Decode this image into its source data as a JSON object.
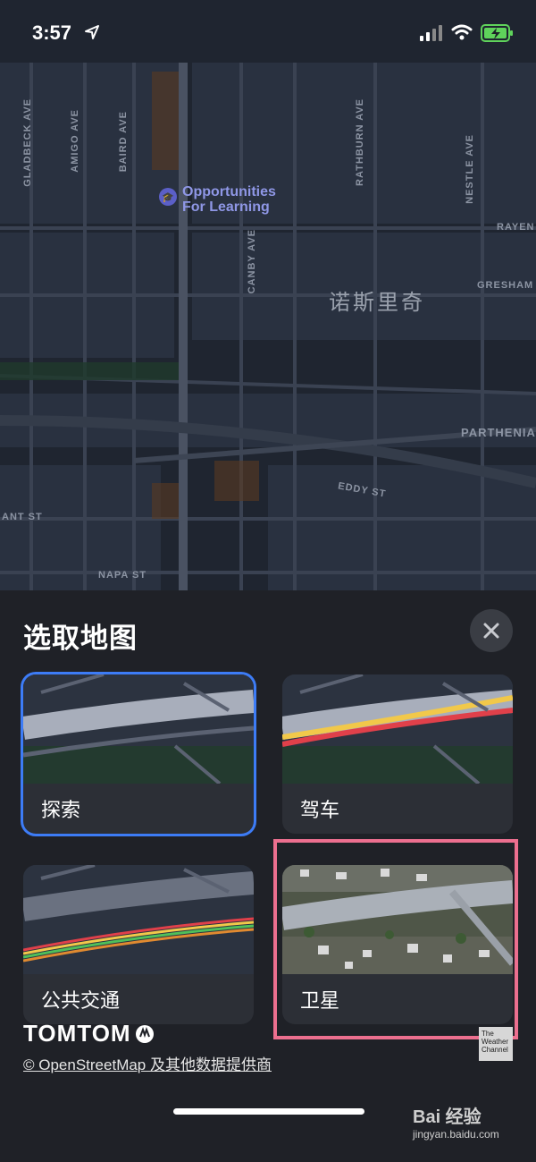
{
  "status_bar": {
    "time": "3:57"
  },
  "map": {
    "city_label": "诺斯里奇",
    "poi": {
      "line1": "Opportunities",
      "line2": "For Learning",
      "icon": "graduation-cap-icon"
    },
    "streets": {
      "gladbeck": "GLADBECK AVE",
      "amigo": "AMIGO AVE",
      "baird": "BAIRD AVE",
      "rathburn": "RATHBURN AVE",
      "nestle": "NESTLE AVE",
      "canby": "CANBY AVE",
      "rayen": "RAYEN",
      "gresham": "GRESHAM",
      "parthenia": "PARTHENIA",
      "eddy": "EDDY ST",
      "ant": "ANT ST",
      "napa": "NAPA ST"
    }
  },
  "sheet": {
    "title": "选取地图",
    "cards": [
      {
        "label": "探索"
      },
      {
        "label": "驾车"
      },
      {
        "label": "公共交通"
      },
      {
        "label": "卫星"
      }
    ],
    "brand": "TOMTOM",
    "attribution": "© OpenStreetMap 及其他数据提供商",
    "weather_logo": "The Weather Channel"
  },
  "watermark": {
    "main": "Bai 经验",
    "sub": "jingyan.baidu.com"
  },
  "colors": {
    "accent": "#3d7cf6",
    "highlight": "#ec6f8f",
    "poi": "#8f97e6"
  }
}
